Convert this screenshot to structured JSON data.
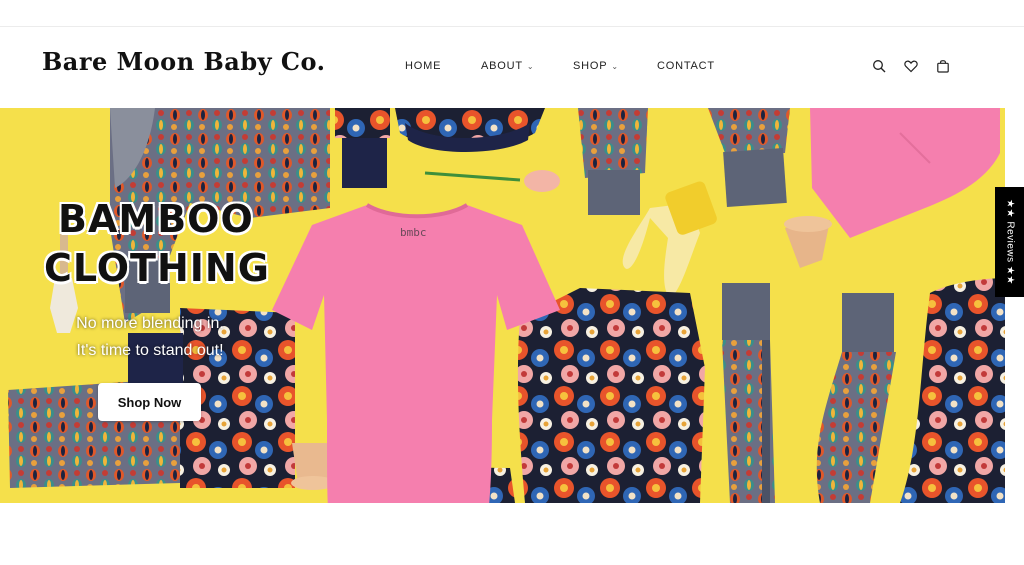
{
  "brand": {
    "name": "Bare Moon Baby Co."
  },
  "nav": {
    "items": [
      {
        "label": "HOME",
        "has_dropdown": false
      },
      {
        "label": "ABOUT",
        "has_dropdown": true
      },
      {
        "label": "SHOP",
        "has_dropdown": true
      },
      {
        "label": "CONTACT",
        "has_dropdown": false
      }
    ]
  },
  "header_icons": [
    "search-icon",
    "heart-icon",
    "shopping-bag-icon"
  ],
  "hero": {
    "title_line1": "BAMBOO",
    "title_line2": "CLOTHING",
    "subtitle_line1": "No more blending in.",
    "subtitle_line2": "It's time to stand out!",
    "cta_label": "Shop Now",
    "tee_print": "bmbc",
    "background_color": "#f5e04b"
  },
  "reviews_tab": {
    "label": "★★ Reviews ★★"
  },
  "colors": {
    "pink": "#f57fae",
    "navy": "#1e2448",
    "grey_band": "#5d6477",
    "yellow": "#f5e04b"
  }
}
